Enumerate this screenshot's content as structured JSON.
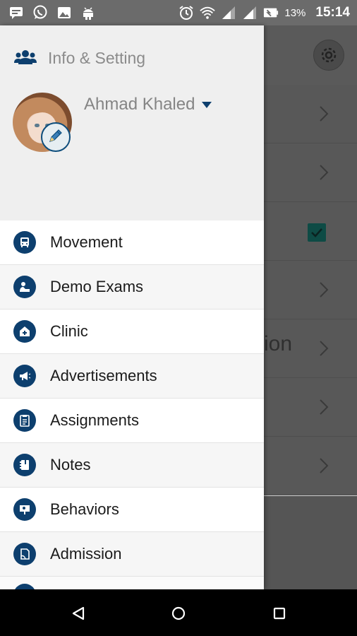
{
  "status_bar": {
    "battery_percent": "13%",
    "time": "15:14",
    "left_icons": [
      "message-icon",
      "whatsapp-icon",
      "image-icon",
      "android-debug-icon"
    ],
    "right_icons": [
      "alarm-icon",
      "wifi-icon",
      "signal-icon",
      "signal-icon",
      "battery-icon"
    ]
  },
  "drawer": {
    "header": {
      "title": "Info & Setting",
      "user_name": "Ahmad Khaled"
    },
    "menu_items": [
      {
        "label": "Movement",
        "icon": "bus-icon"
      },
      {
        "label": "Demo Exams",
        "icon": "student-icon"
      },
      {
        "label": "Clinic",
        "icon": "clinic-icon"
      },
      {
        "label": "Advertisements",
        "icon": "megaphone-icon"
      },
      {
        "label": "Assignments",
        "icon": "clipboard-icon"
      },
      {
        "label": "Notes",
        "icon": "notebook-icon"
      },
      {
        "label": "Behaviors",
        "icon": "board-icon"
      },
      {
        "label": "Admission",
        "icon": "document-icon"
      }
    ]
  },
  "background": {
    "partial_text": "ion"
  },
  "colors": {
    "accent": "#0d3f6e",
    "checkbox": "#0e4b45",
    "status_bar": "#6b6b6b"
  }
}
